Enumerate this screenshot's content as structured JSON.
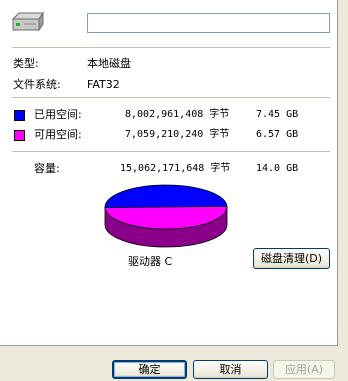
{
  "window": {
    "name_value": ""
  },
  "info": {
    "type_label": "类型:",
    "type_value": "本地磁盘",
    "fs_label": "文件系统:",
    "fs_value": "FAT32"
  },
  "space": {
    "used": {
      "label": "已用空间:",
      "bytes": "8,002,961,408 字节",
      "size": "7.45 GB",
      "color": "#0000ff",
      "fraction": 0.531
    },
    "free": {
      "label": "可用空间:",
      "bytes": "7,059,210,240 字节",
      "size": "6.57 GB",
      "color": "#ff00ff",
      "fraction": 0.469
    },
    "capacity": {
      "label": "容量:",
      "bytes": "15,062,171,648 字节",
      "size": "14.0 GB"
    }
  },
  "drive_label": "驱动器 C",
  "cleanup_button": "磁盘清理(D)",
  "buttons": {
    "ok": "确定",
    "cancel": "取消",
    "apply": "应用(A)"
  }
}
